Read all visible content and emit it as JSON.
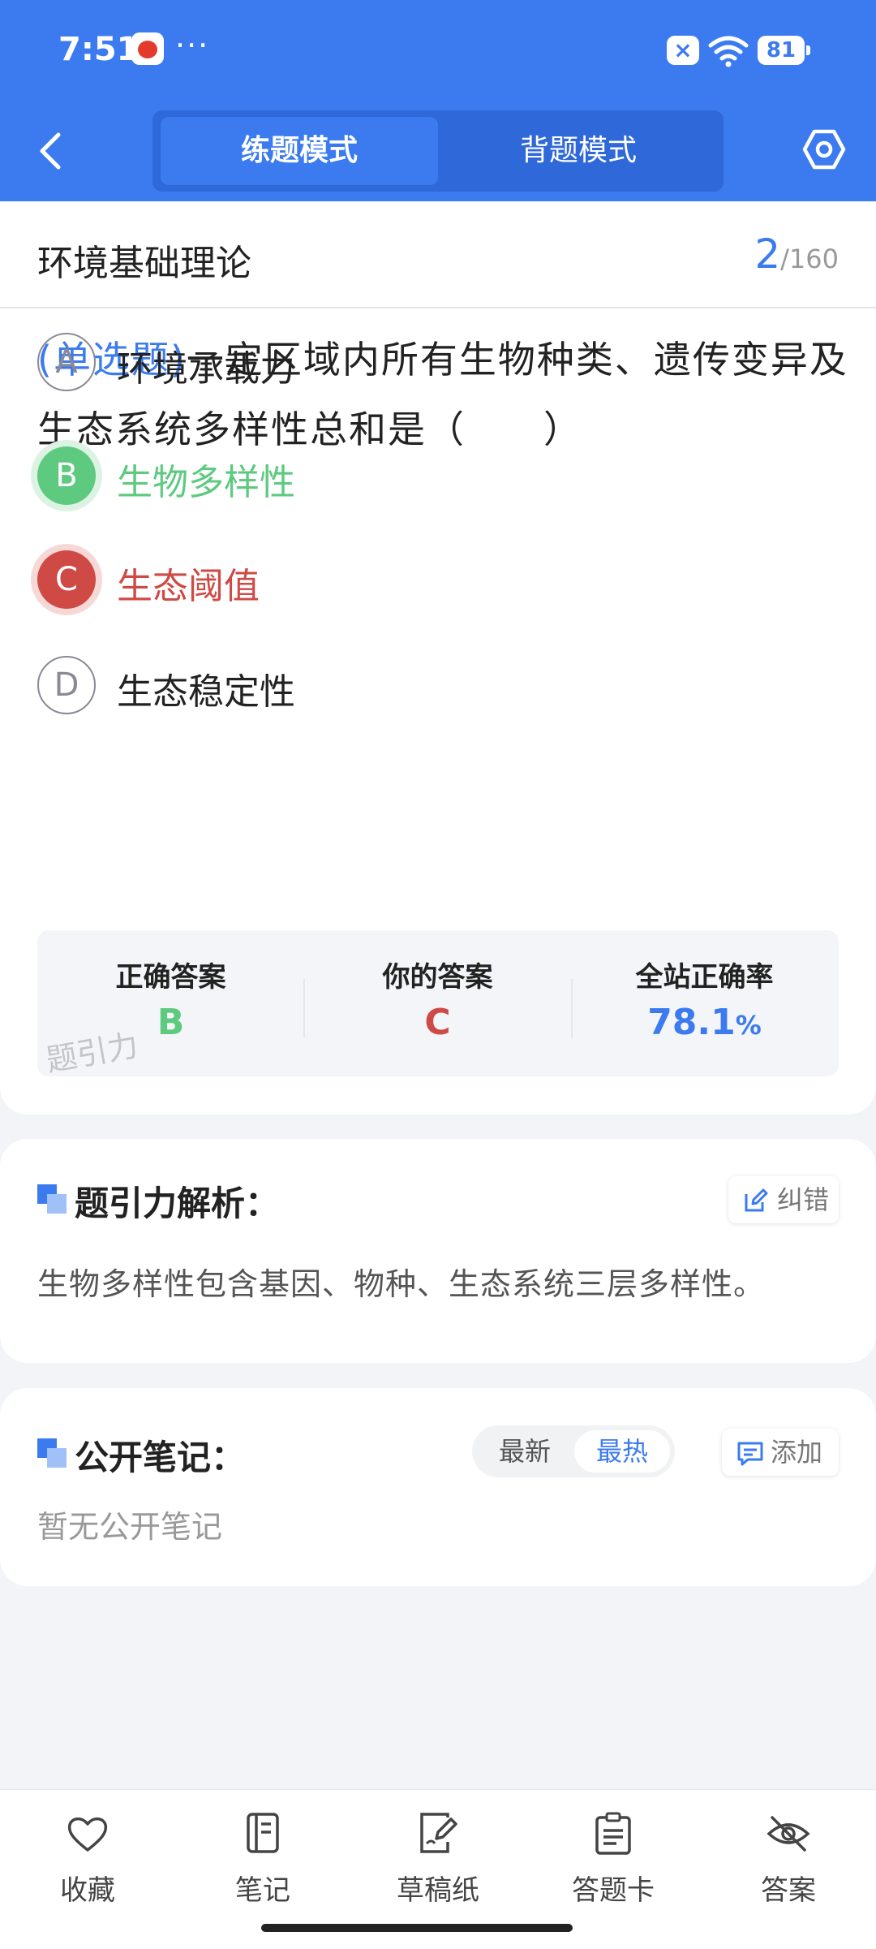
{
  "status_bar": {
    "time": "7:51",
    "dots": "···",
    "battery": "81"
  },
  "header": {
    "mode_tabs": [
      "练题模式",
      "背题模式"
    ],
    "active_mode": "练题模式",
    "accent": "#3b7bef"
  },
  "question_header": {
    "subject": "环境基础理论",
    "current": "2",
    "total": "/160"
  },
  "question": {
    "type": "(单选题)",
    "text": "一定区域内所有生物种类、遗传变异及生态系统多样性总和是（　　）"
  },
  "options": [
    {
      "letter": "A",
      "text": "环境承载力",
      "state": "normal"
    },
    {
      "letter": "B",
      "text": "生物多样性",
      "state": "correct"
    },
    {
      "letter": "C",
      "text": "生态阈值",
      "state": "wrong"
    },
    {
      "letter": "D",
      "text": "生态稳定性",
      "state": "normal"
    }
  ],
  "answer_summary": {
    "correct_label": "正确答案",
    "correct_value": "B",
    "yours_label": "你的答案",
    "yours_value": "C",
    "rate_label": "全站正确率",
    "rate_value": "78.1",
    "rate_unit": "%",
    "watermark": "题引力"
  },
  "analysis": {
    "title": "题引力解析：",
    "correct_btn": "纠错",
    "text": "生物多样性包含基因、物种、生态系统三层多样性。"
  },
  "notes": {
    "title": "公开笔记：",
    "sort_latest": "最新",
    "sort_hot": "最热",
    "active_sort": "最热",
    "add_btn": "添加",
    "empty": "暂无公开笔记"
  },
  "bottom_tabs": [
    {
      "label": "收藏",
      "icon": "heart-icon"
    },
    {
      "label": "笔记",
      "icon": "notebook-icon"
    },
    {
      "label": "草稿纸",
      "icon": "draft-paper-icon"
    },
    {
      "label": "答题卡",
      "icon": "answer-card-icon"
    },
    {
      "label": "答案",
      "icon": "eye-off-icon"
    }
  ],
  "colors": {
    "correct": "#5dca7f",
    "wrong": "#cf4a45",
    "primary": "#3b7bef"
  }
}
